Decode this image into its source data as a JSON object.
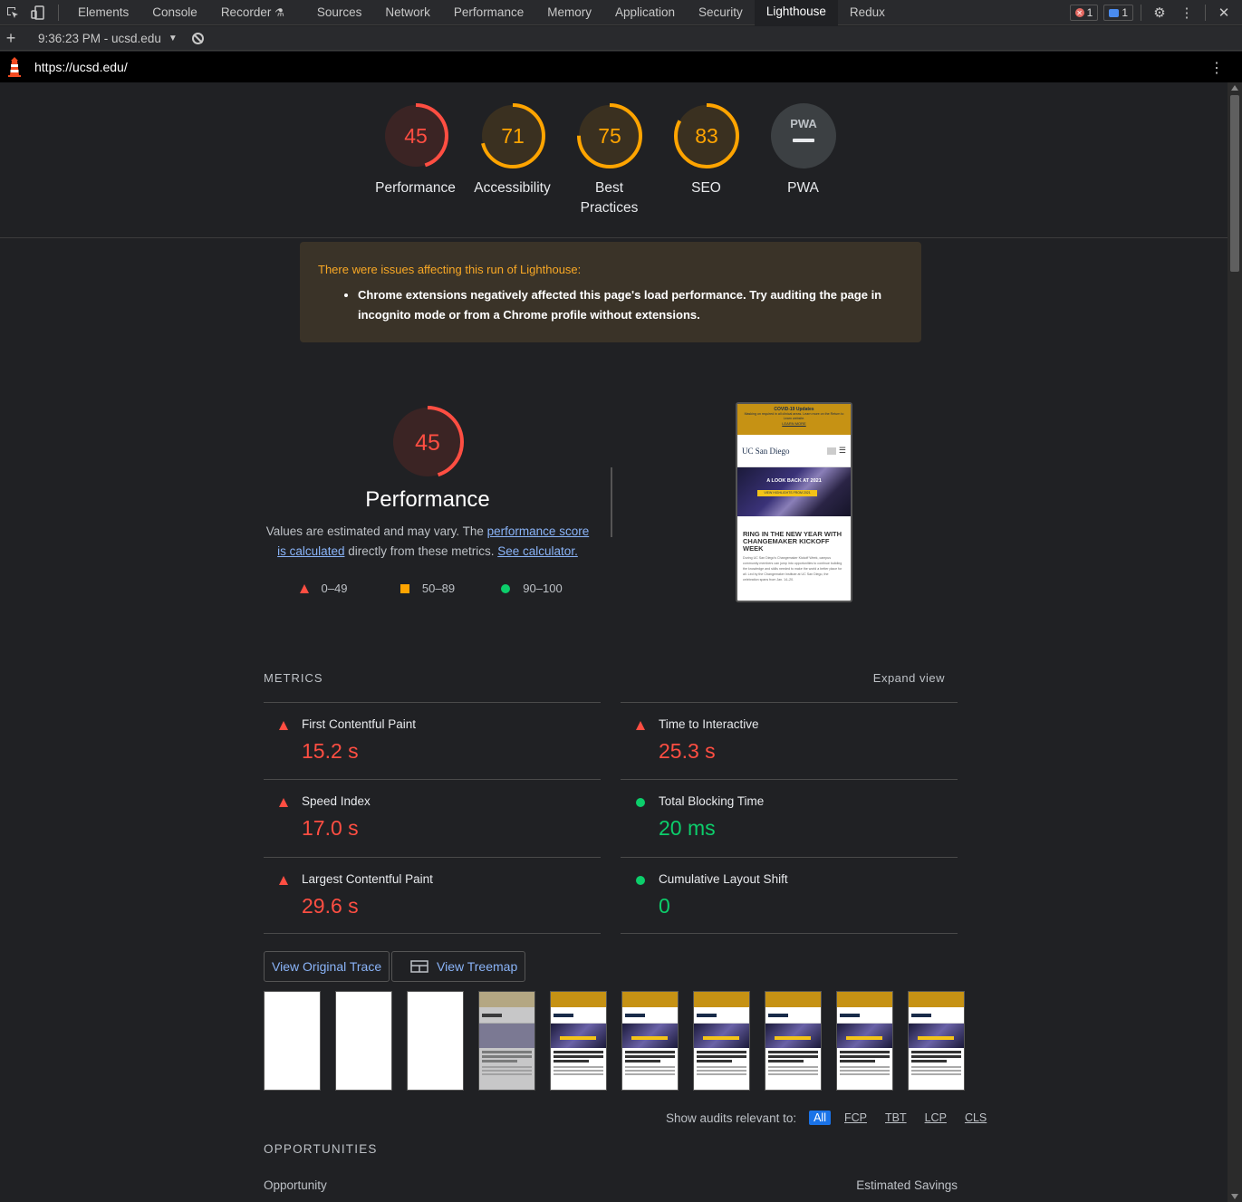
{
  "devtools": {
    "tabs": [
      "Elements",
      "Console",
      "Recorder",
      "Sources",
      "Network",
      "Performance",
      "Memory",
      "Application",
      "Security",
      "Lighthouse",
      "Redux"
    ],
    "active_tab": "Lighthouse",
    "error_count": "1",
    "message_count": "1"
  },
  "subbar": {
    "report": "9:36:23 PM - ucsd.edu"
  },
  "url": "https://ucsd.edu/",
  "gauges": [
    {
      "score": 45,
      "label": "Performance",
      "color": "#ff4e42"
    },
    {
      "score": 71,
      "label": "Accessibility",
      "color": "#ffa400"
    },
    {
      "score": 75,
      "label": "Best Practices",
      "color": "#ffa400"
    },
    {
      "score": 83,
      "label": "SEO",
      "color": "#ffa400"
    },
    {
      "score": null,
      "label": "PWA",
      "color": "#9aa0a6"
    }
  ],
  "pwa_logo": "PWA",
  "warning": {
    "title": "There were issues affecting this run of Lighthouse:",
    "item": "Chrome extensions negatively affected this page's load performance. Try auditing the page in incognito mode or from a Chrome profile without extensions."
  },
  "perf": {
    "score": "45",
    "title": "Performance",
    "desc_1": "Values are estimated and may vary. The ",
    "link_1": "performance score is calculated",
    "desc_2": " directly from these metrics. ",
    "link_2": "See calculator.",
    "legend": [
      "0–49",
      "50–89",
      "90–100"
    ]
  },
  "screenshot": {
    "banner_title": "COVID-19 Updates",
    "banner_text": "Masking on required in all clinical areas. Learn more on the Return to Learn website.",
    "banner_link": "LEARN MORE",
    "logo": "UC San Diego",
    "hero_title": "A LOOK BACK AT 2021",
    "hero_button": "VIEW HIGHLIGHTS FROM 2021",
    "headline": "RING IN THE NEW YEAR WITH CHANGEMAKER KICKOFF WEEK",
    "body": "During UC San Diego's Changemaker Kickoff Week, campus community members can jump into opportunities to continue building the knowledge and skills needed to make the world a better place for all. Led by the Changemaker Institute at UC San Diego, the celebration spans from Jan. 14–20."
  },
  "metrics": {
    "heading": "METRICS",
    "expand": "Expand view",
    "items": [
      {
        "name": "First Contentful Paint",
        "value": "15.2 s",
        "rating": "fail"
      },
      {
        "name": "Time to Interactive",
        "value": "25.3 s",
        "rating": "fail"
      },
      {
        "name": "Speed Index",
        "value": "17.0 s",
        "rating": "fail"
      },
      {
        "name": "Total Blocking Time",
        "value": "20 ms",
        "rating": "pass"
      },
      {
        "name": "Largest Contentful Paint",
        "value": "29.6 s",
        "rating": "fail"
      },
      {
        "name": "Cumulative Layout Shift",
        "value": "0",
        "rating": "pass"
      }
    ]
  },
  "buttons": {
    "trace": "View Original Trace",
    "treemap": "View Treemap"
  },
  "relevant": {
    "label": "Show audits relevant to:",
    "chips": [
      "All",
      "FCP",
      "TBT",
      "LCP",
      "CLS"
    ]
  },
  "opportunities": {
    "heading": "OPPORTUNITIES",
    "col_left": "Opportunity",
    "col_right": "Estimated Savings"
  }
}
